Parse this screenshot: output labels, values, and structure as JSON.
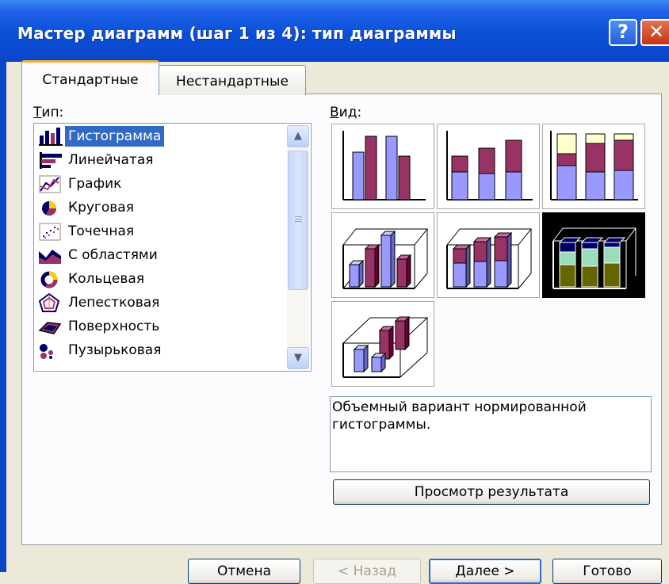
{
  "window": {
    "title": "Мастер диаграмм (шаг 1 из 4): тип диаграммы",
    "help_glyph": "?",
    "close_glyph": "✕"
  },
  "tabs": [
    {
      "label": "Стандартные",
      "active": true
    },
    {
      "label": "Нестандартные",
      "active": false
    }
  ],
  "type_section": {
    "label": "Тип:",
    "selected": "Гистограмма",
    "items": [
      {
        "label": "Гистограмма",
        "icon": "column-chart-icon"
      },
      {
        "label": "Линейчатая",
        "icon": "bar-chart-icon"
      },
      {
        "label": "График",
        "icon": "line-chart-icon"
      },
      {
        "label": "Круговая",
        "icon": "pie-chart-icon"
      },
      {
        "label": "Точечная",
        "icon": "scatter-chart-icon"
      },
      {
        "label": "С областями",
        "icon": "area-chart-icon"
      },
      {
        "label": "Кольцевая",
        "icon": "doughnut-chart-icon"
      },
      {
        "label": "Лепестковая",
        "icon": "radar-chart-icon"
      },
      {
        "label": "Поверхность",
        "icon": "surface-chart-icon"
      },
      {
        "label": "Пузырьковая",
        "icon": "bubble-chart-icon"
      }
    ]
  },
  "view_section": {
    "label": "Вид:",
    "selected_index": 5,
    "description": "Объемный вариант нормированной гистограммы.",
    "preview_button": "Просмотр результата"
  },
  "colors": {
    "series_blue": "#9999ff",
    "series_maroon": "#993366",
    "series_cream": "#ffffcc",
    "selected_olive": "#666600",
    "selected_mint": "#99ddbb",
    "selected_navy": "#000066"
  },
  "buttons": {
    "cancel": "Отмена",
    "back": "< Назад",
    "next": "Далее >",
    "finish": "Готово"
  }
}
